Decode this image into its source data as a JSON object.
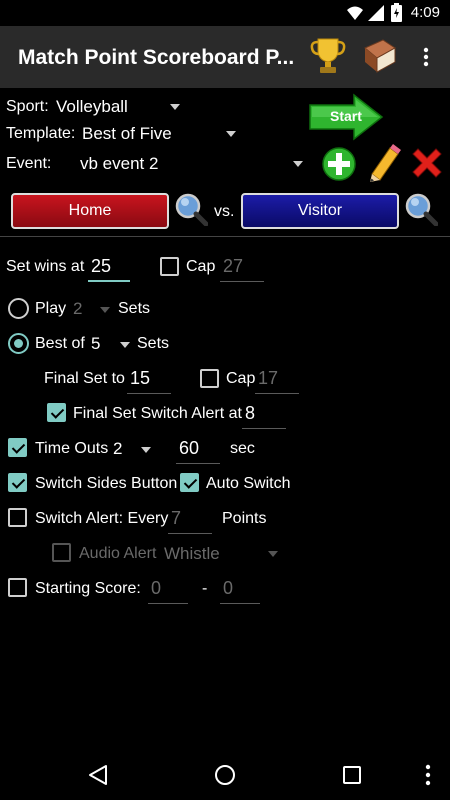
{
  "status_bar": {
    "time": "4:09"
  },
  "app_bar": {
    "title": "Match Point Scoreboard P..."
  },
  "sport": {
    "label": "Sport:",
    "value": "Volleyball"
  },
  "template": {
    "label": "Template:",
    "value": "Best of Five"
  },
  "event": {
    "label": "Event:",
    "value": "vb event 2"
  },
  "start_button": {
    "label": "Start"
  },
  "teams": {
    "home": "Home",
    "vs": "vs.",
    "visitor": "Visitor"
  },
  "set_wins": {
    "label": "Set wins at",
    "value": "25",
    "cap_label": "Cap",
    "cap_value": "27"
  },
  "play": {
    "label": "Play",
    "value": "2",
    "suffix": "Sets"
  },
  "best_of": {
    "label": "Best of",
    "value": "5",
    "suffix": "Sets"
  },
  "final_set": {
    "label": "Final Set to",
    "value": "15",
    "cap_label": "Cap",
    "cap_value": "17"
  },
  "final_set_switch": {
    "label": "Final Set Switch Alert at",
    "value": "8"
  },
  "time_outs": {
    "label": "Time Outs",
    "count": "2",
    "seconds": "60",
    "unit": "sec"
  },
  "switch_sides": {
    "label": "Switch Sides Button",
    "auto_label": "Auto Switch"
  },
  "switch_alert": {
    "label": "Switch Alert: Every",
    "value": "7",
    "suffix": "Points"
  },
  "audio_alert": {
    "label": "Audio Alert",
    "value": "Whistle"
  },
  "starting_score": {
    "label": "Starting Score:",
    "home": "0",
    "dash": "-",
    "visitor": "0"
  },
  "colors": {
    "accent": "#80cbc4",
    "home": "#b0101a",
    "visitor": "#10108a",
    "start": "#2fb52f"
  }
}
